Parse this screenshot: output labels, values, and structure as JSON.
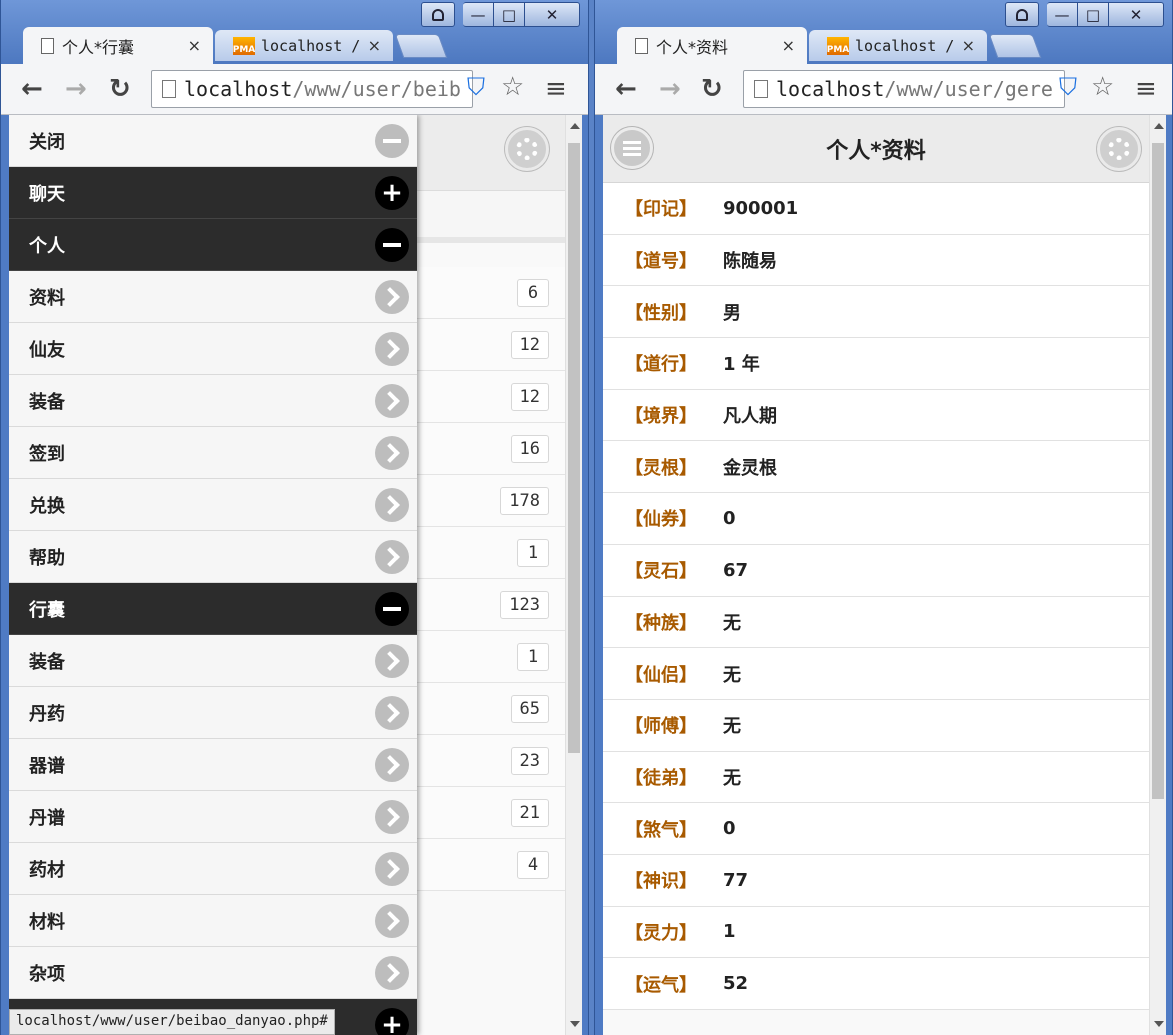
{
  "left_window": {
    "tabs": [
      {
        "title": "个人*行囊",
        "close": "×"
      },
      {
        "title": "localhost /",
        "close": "×"
      }
    ],
    "url_host": "localhost",
    "url_path": "/www/user/beib",
    "status_url": "localhost/www/user/beibao_danyao.php#",
    "panel": {
      "items": [
        {
          "label": "关闭",
          "type": "item",
          "icon": "minus-circle-icon"
        },
        {
          "label": "聊天",
          "type": "head",
          "icon": "plus-circle-icon"
        },
        {
          "label": "个人",
          "type": "head",
          "icon": "minus-circle-icon"
        },
        {
          "label": "资料",
          "type": "item",
          "icon": "arrow-right-circle-icon"
        },
        {
          "label": "仙友",
          "type": "item",
          "icon": "arrow-right-circle-icon"
        },
        {
          "label": "装备",
          "type": "item",
          "icon": "arrow-right-circle-icon"
        },
        {
          "label": "签到",
          "type": "item",
          "icon": "arrow-right-circle-icon"
        },
        {
          "label": "兑换",
          "type": "item",
          "icon": "arrow-right-circle-icon"
        },
        {
          "label": "帮助",
          "type": "item",
          "icon": "arrow-right-circle-icon"
        },
        {
          "label": "行囊",
          "type": "head",
          "icon": "minus-circle-icon"
        },
        {
          "label": "装备",
          "type": "item",
          "icon": "arrow-right-circle-icon"
        },
        {
          "label": "丹药",
          "type": "item",
          "icon": "arrow-right-circle-icon"
        },
        {
          "label": "器谱",
          "type": "item",
          "icon": "arrow-right-circle-icon"
        },
        {
          "label": "丹谱",
          "type": "item",
          "icon": "arrow-right-circle-icon"
        },
        {
          "label": "药材",
          "type": "item",
          "icon": "arrow-right-circle-icon"
        },
        {
          "label": "材料",
          "type": "item",
          "icon": "arrow-right-circle-icon"
        },
        {
          "label": "杂项",
          "type": "item",
          "icon": "arrow-right-circle-icon"
        },
        {
          "label": "",
          "type": "head",
          "icon": "plus-circle-icon"
        }
      ]
    },
    "counts": [
      "6",
      "12",
      "12",
      "16",
      "178",
      "1",
      "123",
      "1",
      "65",
      "23",
      "21",
      "4"
    ]
  },
  "right_window": {
    "tabs": [
      {
        "title": "个人*资料",
        "close": "×"
      },
      {
        "title": "localhost /",
        "close": "×"
      }
    ],
    "url_host": "localhost",
    "url_path": "/www/user/gere",
    "page_title": "个人*资料",
    "fields": [
      {
        "key": "【印记】",
        "value": "900001"
      },
      {
        "key": "【道号】",
        "value": "陈随易"
      },
      {
        "key": "【性别】",
        "value": "男"
      },
      {
        "key": "【道行】",
        "value": "1 年"
      },
      {
        "key": "【境界】",
        "value": "凡人期"
      },
      {
        "key": "【灵根】",
        "value": "金灵根"
      },
      {
        "key": "【仙券】",
        "value": "0"
      },
      {
        "key": "【灵石】",
        "value": "67"
      },
      {
        "key": "【种族】",
        "value": "无"
      },
      {
        "key": "【仙侣】",
        "value": "无"
      },
      {
        "key": "【师傅】",
        "value": "无"
      },
      {
        "key": "【徒弟】",
        "value": "无"
      },
      {
        "key": "【煞气】",
        "value": "0"
      },
      {
        "key": "【神识】",
        "value": "77"
      },
      {
        "key": "【灵力】",
        "value": "1"
      },
      {
        "key": "【运气】",
        "value": "52"
      }
    ]
  },
  "colors": {
    "field_key": "#a85a00",
    "panel_header": "#2c2c2c",
    "frame": "#4f7bc4"
  }
}
